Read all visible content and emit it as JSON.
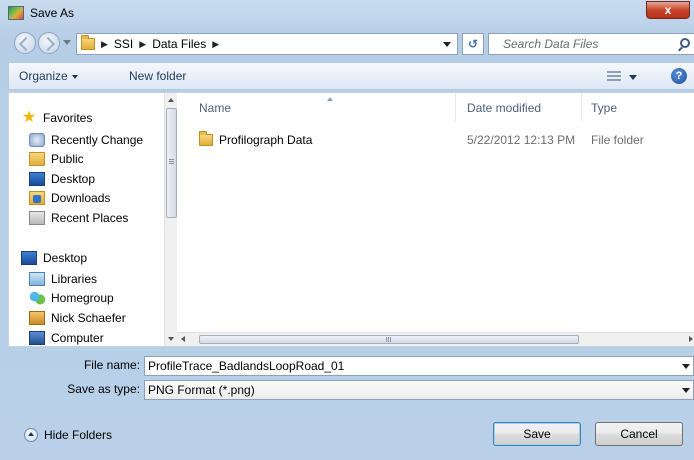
{
  "window": {
    "title": "Save As",
    "close_label": "x"
  },
  "address": {
    "crumbs": [
      "SSI",
      "Data Files"
    ],
    "search_placeholder": "Search Data Files"
  },
  "toolbar": {
    "organize": "Organize",
    "new_folder": "New folder",
    "help": "?"
  },
  "navpane": {
    "favorites": "Favorites",
    "favorites_items": [
      "Recently Change",
      "Public",
      "Desktop",
      "Downloads",
      "Recent Places"
    ],
    "desktop": "Desktop",
    "desktop_items": [
      "Libraries",
      "Homegroup",
      "Nick Schaefer",
      "Computer"
    ]
  },
  "filelist": {
    "columns": [
      "Name",
      "Date modified",
      "Type"
    ],
    "rows": [
      {
        "name": "Profilograph Data",
        "date": "5/22/2012 12:13 PM",
        "type": "File folder"
      }
    ],
    "hscroll_grip": "III"
  },
  "form": {
    "file_name_label": "File name:",
    "file_name_value": "ProfileTrace_BadlandsLoopRoad_01",
    "save_as_type_label": "Save as type:",
    "save_as_type_value": "PNG Format (*.png)"
  },
  "footer": {
    "hide_folders": "Hide Folders",
    "save": "Save",
    "cancel": "Cancel"
  },
  "colors": {
    "frame": "#b9d0e8",
    "accent": "#3c7fb1",
    "close": "#c7452b"
  }
}
